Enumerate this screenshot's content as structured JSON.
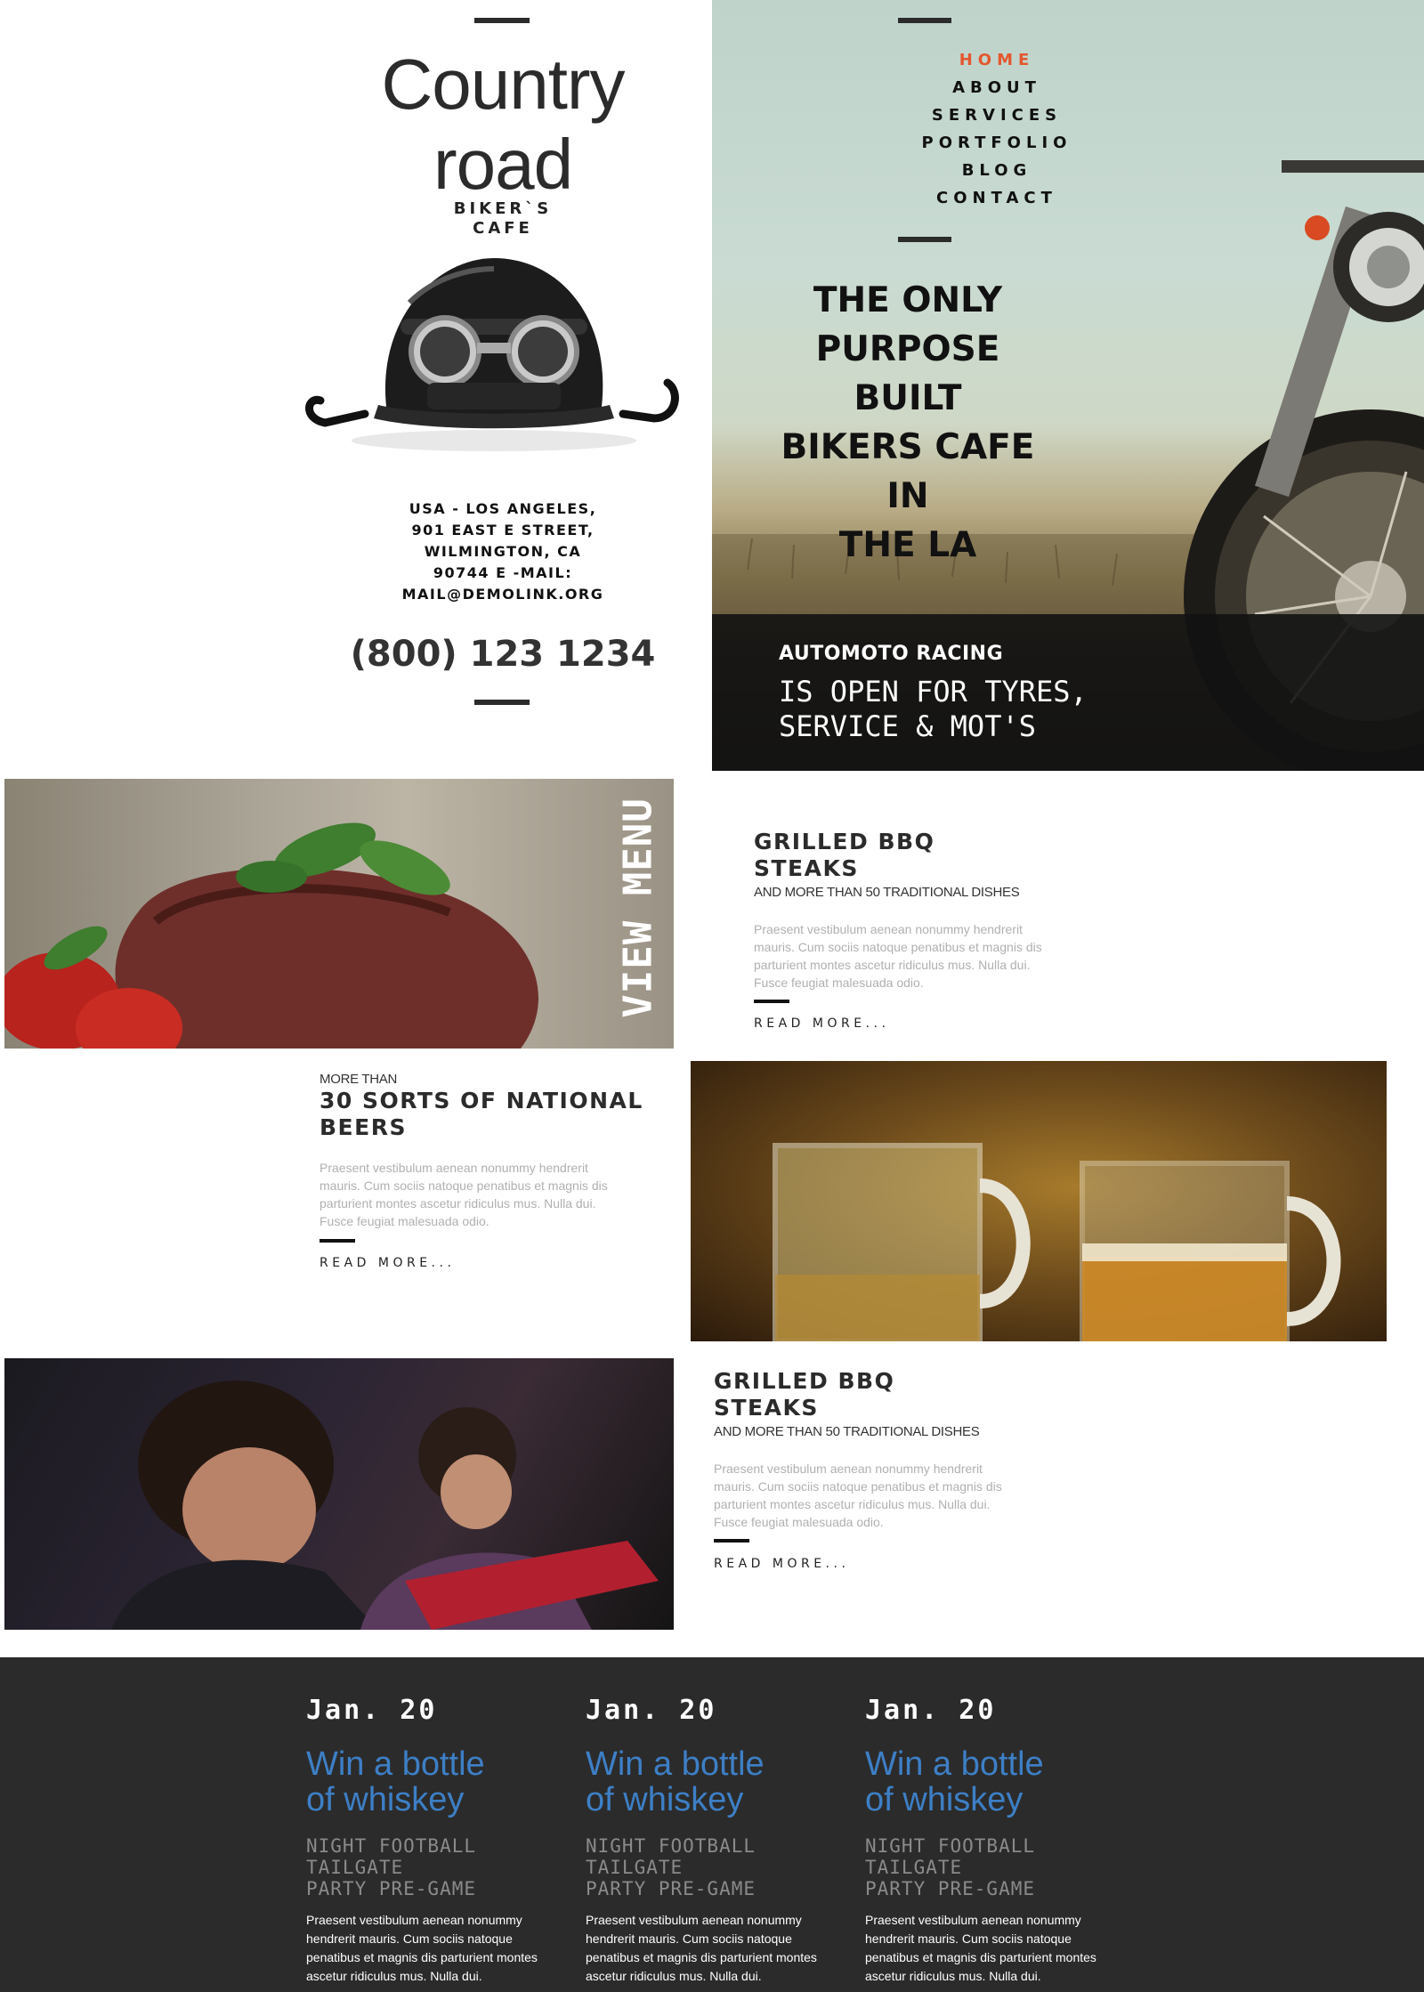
{
  "brand": {
    "name_line1": "Country",
    "name_line2": "road",
    "tag_line1": "BIKER`S",
    "tag_line2": "CAFE"
  },
  "contact": {
    "address": [
      "USA - LOS ANGELES,",
      "901 EAST E STREET,",
      "WILMINGTON, CA",
      "90744 E -MAIL:",
      "MAIL@DEMOLINK.ORG"
    ],
    "phone": "(800) 123 1234"
  },
  "nav": {
    "items": [
      {
        "label": "HOME",
        "active": true
      },
      {
        "label": "ABOUT",
        "active": false
      },
      {
        "label": "SERVICES",
        "active": false
      },
      {
        "label": "PORTFOLIO",
        "active": false
      },
      {
        "label": "BLOG",
        "active": false
      },
      {
        "label": "CONTACT",
        "active": false
      }
    ],
    "active_color": "#e4572e"
  },
  "hero": {
    "title": [
      "THE ONLY",
      "PURPOSE BUILT",
      "BIKERS CAFE IN",
      "THE LA"
    ],
    "band_small": "AUTOMOTO RACING",
    "band_big_line1": "IS OPEN FOR TYRES,",
    "band_big_line2": "SERVICE & MOT'S"
  },
  "menu_block": {
    "view_menu_label": "VIEW MENU",
    "title_line1": "GRILLED BBQ",
    "title_line2": "STEAKS",
    "subtitle": "AND MORE THAN 50 TRADITIONAL DISHES",
    "text": [
      "Praesent vestibulum aenean nonummy hendrerit",
      "mauris. Cum sociis natoque penatibus et magnis dis",
      "parturient montes ascetur ridiculus mus. Nulla dui.",
      "Fusce feugiat malesuada odio."
    ],
    "read_more": "READ MORE..."
  },
  "beer_block": {
    "kicker": "MORE THAN",
    "title_line1": "30 SORTS OF NATIONAL",
    "title_line2": "BEERS",
    "text": [
      "Praesent vestibulum aenean nonummy hendrerit",
      "mauris. Cum sociis natoque penatibus et magnis dis",
      "parturient montes ascetur ridiculus mus. Nulla dui.",
      "Fusce feugiat malesuada odio."
    ],
    "read_more": "READ MORE..."
  },
  "bbq_block": {
    "title_line1": "GRILLED BBQ",
    "title_line2": "STEAKS",
    "subtitle": "AND MORE THAN 50 TRADITIONAL DISHES",
    "text": [
      "Praesent vestibulum aenean nonummy hendrerit",
      "mauris. Cum sociis natoque penatibus et magnis dis",
      "parturient montes ascetur ridiculus mus. Nulla dui.",
      "Fusce feugiat malesuada odio."
    ],
    "read_more": "READ MORE..."
  },
  "events": [
    {
      "date": "Jan. 20",
      "title_line1": "Win a bottle",
      "title_line2": "of whiskey",
      "cap": [
        "NIGHT FOOTBALL",
        "TAILGATE",
        "PARTY PRE-GAME"
      ],
      "text": "Praesent vestibulum aenean nonummy hendrerit mauris. Cum sociis natoque penatibus et magnis dis parturient montes ascetur ridiculus mus. Nulla dui."
    },
    {
      "date": "Jan. 20",
      "title_line1": "Win a bottle",
      "title_line2": "of whiskey",
      "cap": [
        "NIGHT FOOTBALL",
        "TAILGATE",
        "PARTY PRE-GAME"
      ],
      "text": "Praesent vestibulum aenean nonummy hendrerit mauris. Cum sociis natoque penatibus et magnis dis parturient montes ascetur ridiculus mus. Nulla dui."
    },
    {
      "date": "Jan. 20",
      "title_line1": "Win a bottle",
      "title_line2": "of whiskey",
      "cap": [
        "NIGHT FOOTBALL",
        "TAILGATE",
        "PARTY PRE-GAME"
      ],
      "text": "Praesent vestibulum aenean nonummy hendrerit mauris. Cum sociis natoque penatibus et magnis dis parturient montes ascetur ridiculus mus. Nulla dui."
    }
  ],
  "colors": {
    "accent_orange": "#e4572e",
    "link_blue": "#3d7fc6",
    "footer_bg": "#2b2b2b",
    "text_dark": "#2b2b2b"
  }
}
